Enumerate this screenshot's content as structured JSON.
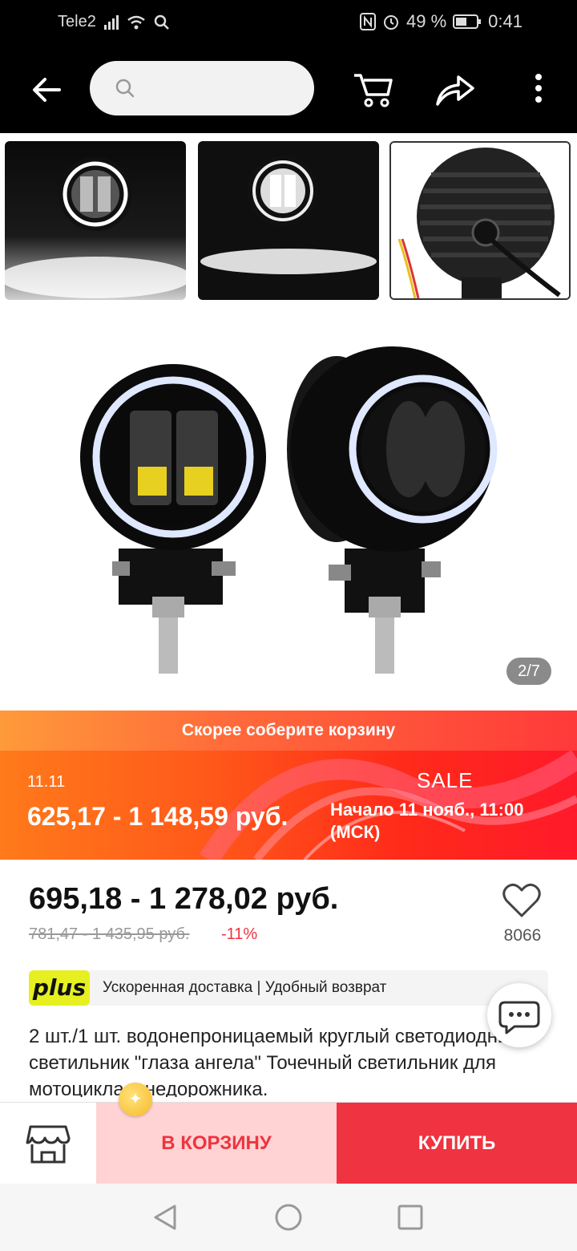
{
  "status": {
    "carrier": "Tele2",
    "battery": "49 %",
    "time": "0:41"
  },
  "icons": {
    "back": "arrow-left-icon",
    "search": "search-icon",
    "cart": "cart-icon",
    "share": "share-icon",
    "more": "more-vertical-icon",
    "favorite": "heart-icon",
    "chat": "chat-icon",
    "store": "store-icon",
    "coin": "coin-icon"
  },
  "search": {
    "placeholder": ""
  },
  "gallery": {
    "counter": "2/7"
  },
  "promo": {
    "header": "Скорее соберите корзину",
    "date": "11.11",
    "price_range": "625,17 - 1 148,59 руб.",
    "sale": "SALE",
    "start": "Начало 11 нояб., 11:00 (МСК)"
  },
  "product": {
    "price": "695,18 - 1 278,02 руб.",
    "old_price": "781,47 - 1 435,95 руб.",
    "discount": "-11%",
    "favorites": "8066",
    "plus_logo": "plus",
    "plus_text": "Ускоренная доставка | Удобный возврат",
    "title": "2 шт./1 шт. водонепроницаемый круглый светодиодный светильник \"глаза ангела\" Точечный светильник для мотоцикла, внедорожника."
  },
  "actions": {
    "cart": "В КОРЗИНУ",
    "buy": "КУПИТЬ"
  },
  "colors": {
    "accent": "#ef3340",
    "cart_bg": "#ffd3d3",
    "plus": "#e6f020"
  }
}
